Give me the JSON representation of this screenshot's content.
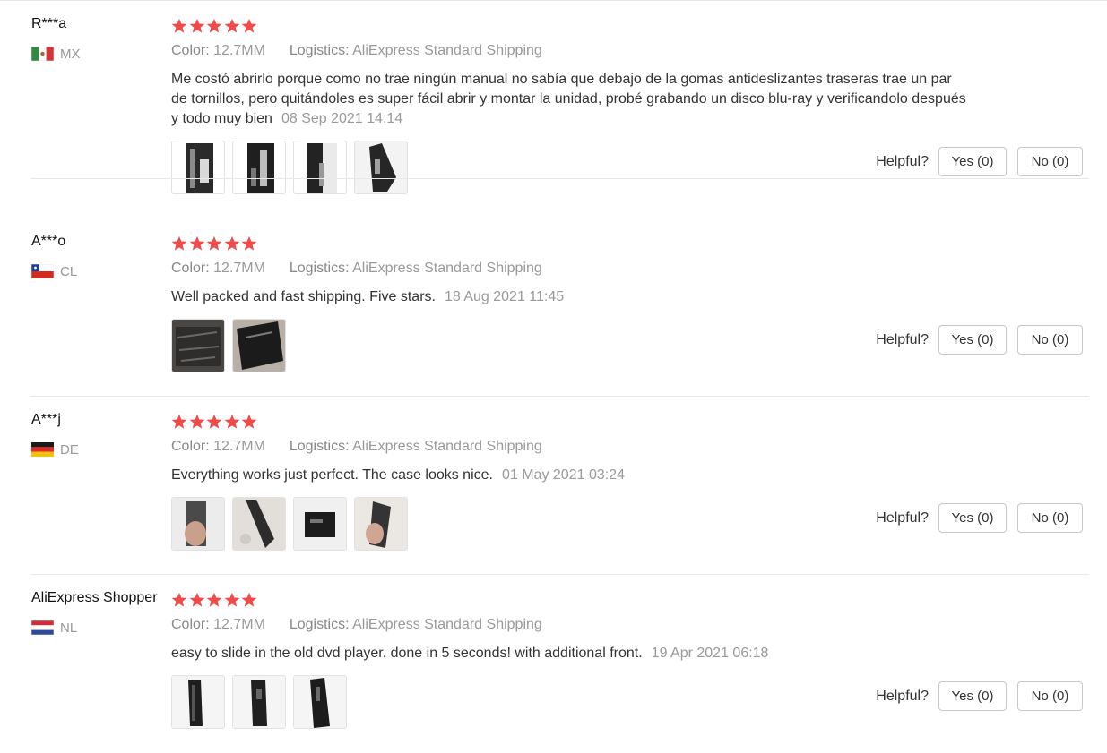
{
  "helpful_label": "Helpful?",
  "star_color": "#f04b4b",
  "reviews": [
    {
      "user": "R***a",
      "country": "MX",
      "flag": "mexico-flag-icon",
      "stars": 5,
      "color_label": "Color:",
      "color_value": "12.7MM",
      "logistics_label": "Logistics:",
      "logistics_value": "AliExpress Standard Shipping",
      "text": "Me costó abrirlo porque como no trae ningún manual no sabía que debajo de la gomas antideslizantes traseras trae un par de tornillos, pero quitándoles es super fácil abrir y montar la unidad, probé grabando un disco blu-ray y verificandolo después y todo muy bien",
      "date": "08 Sep 2021 14:14",
      "yes": "Yes (0)",
      "no": "No (0)",
      "photos": 4
    },
    {
      "user": "A***o",
      "country": "CL",
      "flag": "chile-flag-icon",
      "stars": 5,
      "color_label": "Color:",
      "color_value": "12.7MM",
      "logistics_label": "Logistics:",
      "logistics_value": "AliExpress Standard Shipping",
      "text": "Well packed and fast shipping. Five stars.",
      "date": "18 Aug 2021 11:45",
      "yes": "Yes (0)",
      "no": "No (0)",
      "photos": 2
    },
    {
      "user": "A***j",
      "country": "DE",
      "flag": "germany-flag-icon",
      "stars": 5,
      "color_label": "Color:",
      "color_value": "12.7MM",
      "logistics_label": "Logistics:",
      "logistics_value": "AliExpress Standard Shipping",
      "text": "Everything works just perfect. The case looks nice.",
      "date": "01 May 2021 03:24",
      "yes": "Yes (0)",
      "no": "No (0)",
      "photos": 4
    },
    {
      "user": "AliExpress Shopper",
      "country": "NL",
      "flag": "netherlands-flag-icon",
      "stars": 5,
      "color_label": "Color:",
      "color_value": "12.7MM",
      "logistics_label": "Logistics:",
      "logistics_value": "AliExpress Standard Shipping",
      "text": "easy to slide in the old dvd player. done in 5 seconds! with additional front.",
      "date": "19 Apr 2021 06:18",
      "yes": "Yes (0)",
      "no": "No (0)",
      "photos": 3
    }
  ]
}
